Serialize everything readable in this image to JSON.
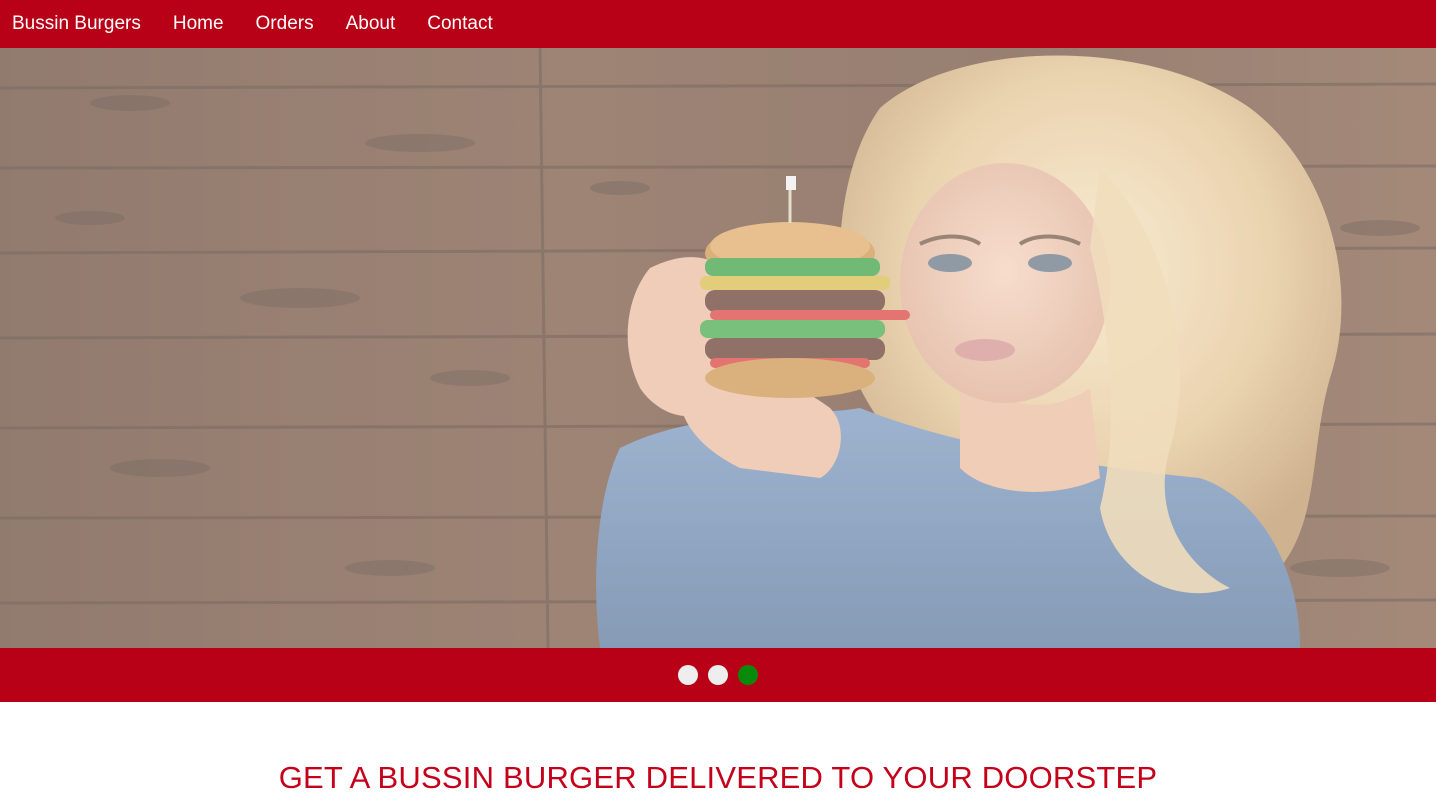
{
  "nav": {
    "brand": "Bussin Burgers",
    "links": [
      "Home",
      "Orders",
      "About",
      "Contact"
    ]
  },
  "hero": {
    "image": "woman-holding-burger-photo"
  },
  "carousel": {
    "slide_count": 3,
    "active_index": 2
  },
  "main": {
    "headline": "GET A BUSSIN BURGER DELIVERED TO YOUR DOORSTEP"
  },
  "colors": {
    "brand_red": "#b80016",
    "headline_red": "#c4001a",
    "active_dot": "#0a8a0a",
    "inactive_dot": "#eeeeee"
  }
}
